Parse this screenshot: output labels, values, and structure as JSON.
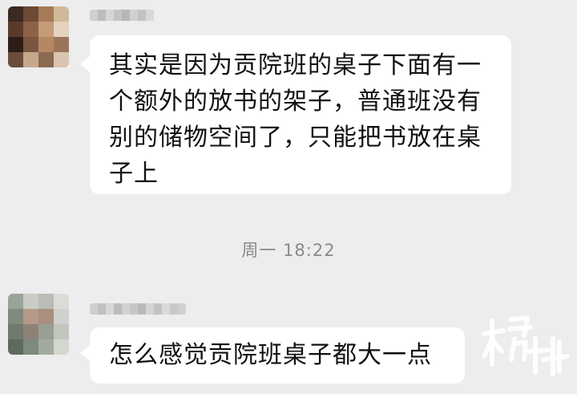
{
  "messages": [
    {
      "text": "其实是因为贡院班的桌子下面有一个额外的放书的架子，普通班没有别的储物空间了，只能把书放在桌子上"
    },
    {
      "text": "怎么感觉贡院班桌子都大一点"
    }
  ],
  "timestamp": "周一 18:22",
  "colors": {
    "background": "#ededed",
    "bubble": "#ffffff",
    "text": "#111111",
    "timestamp": "#8a8a8a"
  }
}
